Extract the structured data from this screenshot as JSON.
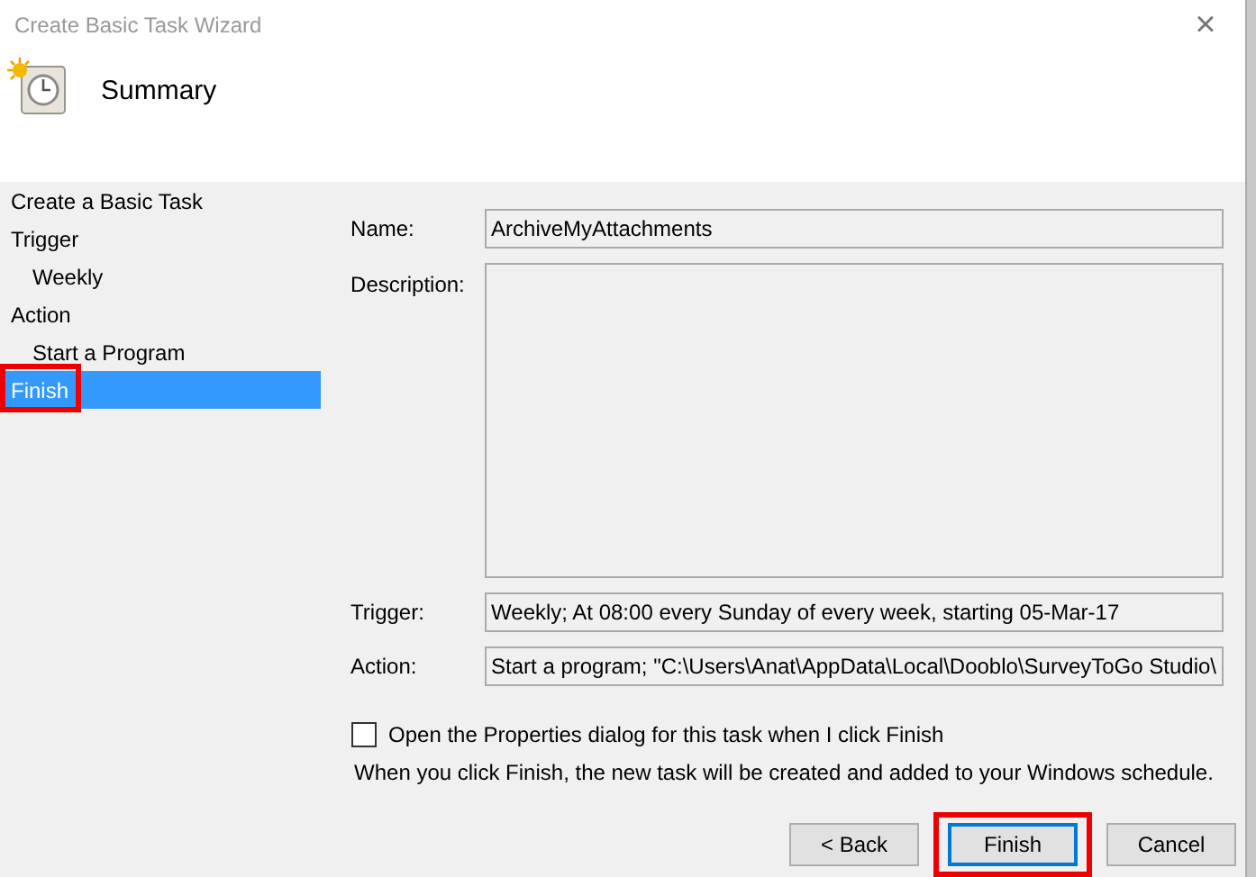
{
  "window": {
    "title": "Create Basic Task Wizard",
    "close": "×"
  },
  "header": {
    "title": "Summary"
  },
  "sidebar": {
    "items": [
      {
        "label": "Create a Basic Task",
        "selected": false,
        "highlighted": false
      },
      {
        "label": "Trigger",
        "selected": false,
        "highlighted": false,
        "children": [
          {
            "label": "Weekly",
            "selected": false,
            "highlighted": false
          }
        ]
      },
      {
        "label": "Action",
        "selected": false,
        "highlighted": false,
        "children": [
          {
            "label": "Start a Program",
            "selected": false,
            "highlighted": false
          }
        ]
      },
      {
        "label": "Finish",
        "selected": true,
        "highlighted": true
      }
    ]
  },
  "fields": [
    {
      "label": "Name:",
      "value": "ArchiveMyAttachments",
      "kind": "line"
    },
    {
      "label": "Description:",
      "kind": "area"
    },
    {
      "label": "Trigger:",
      "value": "Weekly; At 08:00 every Sunday of every week, starting 05-Mar-17",
      "kind": "line"
    },
    {
      "label": "Action:",
      "value": "Start a program; \"C:\\Users\\Anat\\AppData\\Local\\Dooblo\\SurveyToGo Studio\\",
      "kind": "line"
    }
  ],
  "open_properties": {
    "label": "Open the Properties dialog for this task when I click Finish",
    "checked": false
  },
  "note": "When you click Finish, the new task will be created and added to your Windows schedule.",
  "buttons": [
    {
      "label": "< Back",
      "default": false,
      "highlighted": false
    },
    {
      "label": "Finish",
      "default": true,
      "highlighted": true
    },
    {
      "label": "Cancel",
      "default": false,
      "highlighted": false
    }
  ]
}
